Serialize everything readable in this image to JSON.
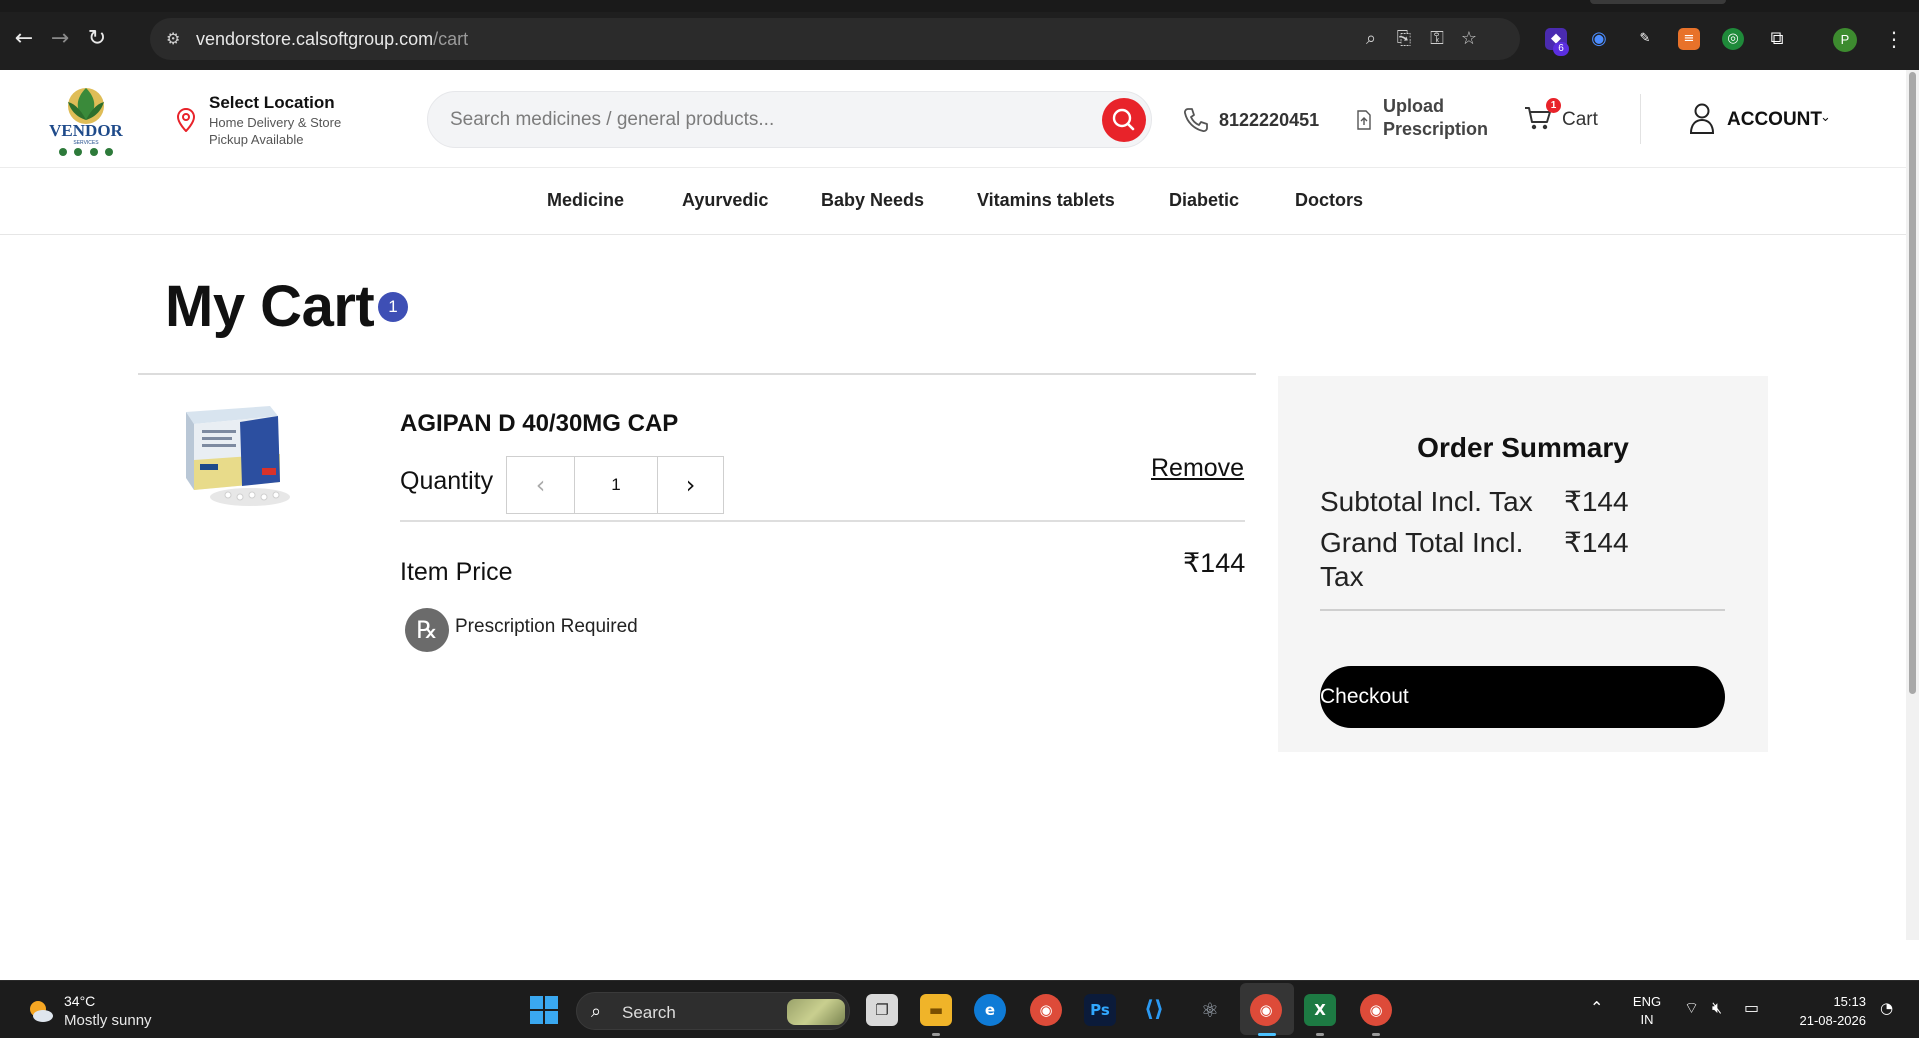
{
  "browser": {
    "url_host": "vendorstore.calsoftgroup.com",
    "url_path": "/cart",
    "extension_badge": "6",
    "profile_initial": "P"
  },
  "header": {
    "location_title": "Select Location",
    "location_sub": "Home Delivery & Store Pickup Available",
    "search_placeholder": "Search medicines / general products...",
    "phone": "8122220451",
    "upload_label": "Upload Prescription",
    "cart_label": "Cart",
    "cart_count": "1",
    "account_label": "ACCOUNT"
  },
  "nav": {
    "items": [
      "Medicine",
      "Ayurvedic",
      "Baby Needs",
      "Vitamins tablets",
      "Diabetic",
      "Doctors"
    ]
  },
  "cart": {
    "title": "My Cart",
    "count": "1",
    "item": {
      "name": "AGIPAN D 40/30MG CAP",
      "quantity_label": "Quantity",
      "quantity": "1",
      "remove_label": "Remove",
      "price_label": "Item Price",
      "price": "₹144",
      "prescription_label": "Prescription Required"
    }
  },
  "summary": {
    "title": "Order Summary",
    "subtotal_label": "Subtotal Incl. Tax",
    "subtotal_value": "₹144",
    "grand_total_label": "Grand Total Incl. Tax",
    "grand_total_value": "₹144",
    "checkout_label": "Checkout"
  },
  "taskbar": {
    "weather_temp": "34°C",
    "weather_desc": "Mostly sunny",
    "search_label": "Search",
    "lang_1": "ENG",
    "lang_2": "IN",
    "time": "15:13",
    "date": "21-08-2026"
  },
  "icons": {
    "brand_red": "#e8232a",
    "badge_blue": "#3e4fb5"
  }
}
